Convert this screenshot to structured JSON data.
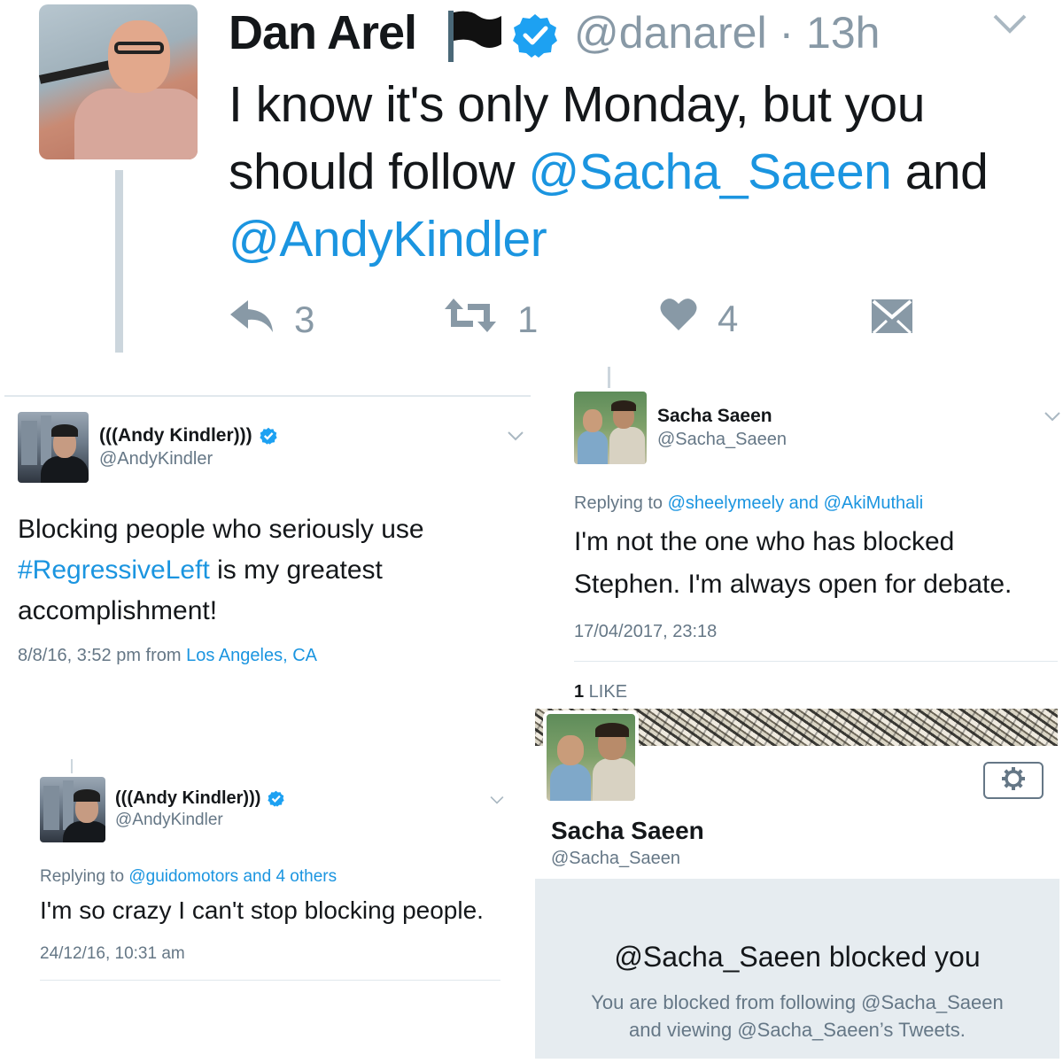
{
  "top_tweet": {
    "name": "Dan Arel",
    "handle": "@danarel",
    "time": "· 13h",
    "text_part1": "I know it's only Monday, but you should follow ",
    "mention1": "@Sacha_Saeen",
    "text_part2": " and ",
    "mention2": "@AndyKindler",
    "reply_count": "3",
    "retweet_count": "1",
    "like_count": "4",
    "icons": [
      "reply-icon",
      "retweet-icon",
      "heart-icon",
      "dm-icon",
      "flag-icon",
      "verified-icon",
      "chevron-down-icon"
    ]
  },
  "andy_tweet_1": {
    "name": "(((Andy Kindler)))",
    "handle": "@AndyKindler",
    "text_part1": "Blocking people who seriously use ",
    "hashtag": "#RegressiveLeft",
    "text_part2": " is my greatest accomplishment!",
    "meta_date": "8/8/16, 3:52 pm from ",
    "meta_location": "Los Angeles, CA"
  },
  "sacha_tweet": {
    "name": "Sacha Saeen",
    "handle": "@Sacha_Saeen",
    "replying_prefix": "Replying to ",
    "replying_user1": "@sheelymeely",
    "replying_and": " and ",
    "replying_user2": "@AkiMuthali",
    "text": "I'm not the one who has blocked Stephen. I'm always open for debate.",
    "timestamp": "17/04/2017, 23:18",
    "like_count": "1",
    "like_label": " LIKE"
  },
  "andy_tweet_2": {
    "name": "(((Andy Kindler)))",
    "handle": "@AndyKindler",
    "replying_prefix": "Replying to ",
    "replying_users": "@guidomotors and 4 others",
    "text": "I'm so crazy I can't stop blocking people.",
    "timestamp": "24/12/16, 10:31 am"
  },
  "profile": {
    "name": "Sacha Saeen",
    "handle": "@Sacha_Saeen",
    "blocked_title": "@Sacha_Saeen blocked you",
    "blocked_desc_line1": "You are blocked from following @Sacha_Saeen",
    "blocked_desc_line2": "and viewing @Sacha_Saeen’s Tweets."
  },
  "colors": {
    "link": "#1b95e0",
    "verified": "#1da1f2",
    "muted": "#8899a6",
    "blocked_bg": "#e6ecf0"
  }
}
